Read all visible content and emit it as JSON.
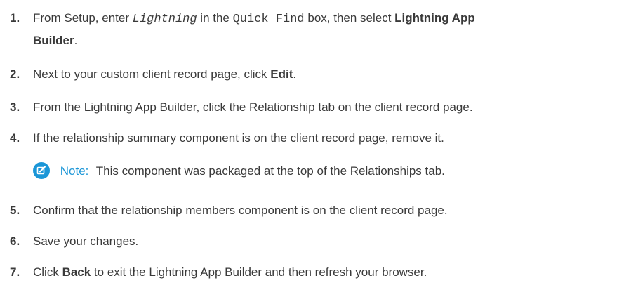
{
  "steps": [
    {
      "number": "1.",
      "line1_a": "From Setup, enter ",
      "line1_code": "Lightning",
      "line1_b": " in the ",
      "line1_code2": "Quick Find",
      "line1_c": " box, then select ",
      "line1_bold": "Lightning App",
      "line2_bold": "Builder",
      "line2_end": "."
    },
    {
      "number": "2.",
      "text_a": "Next to your custom client record page, click ",
      "text_bold": "Edit",
      "text_b": "."
    },
    {
      "number": "3.",
      "text": "From the Lightning App Builder, click the Relationship tab on the client record page."
    },
    {
      "number": "4.",
      "text": "If the relationship summary component is on the client record page, remove it."
    },
    {
      "number": "5.",
      "text": "Confirm that the relationship members component is on the client record page."
    },
    {
      "number": "6.",
      "text": "Save your changes."
    },
    {
      "number": "7.",
      "text_a": "Click ",
      "text_bold": "Back",
      "text_b": " to exit the Lightning App Builder and then refresh your browser."
    }
  ],
  "note": {
    "icon": "edit-note-icon",
    "label": "Note:",
    "text": "This component was packaged at the top of the Relationships tab."
  },
  "colors": {
    "text": "#3a3a3a",
    "accent": "#1b96d7"
  }
}
